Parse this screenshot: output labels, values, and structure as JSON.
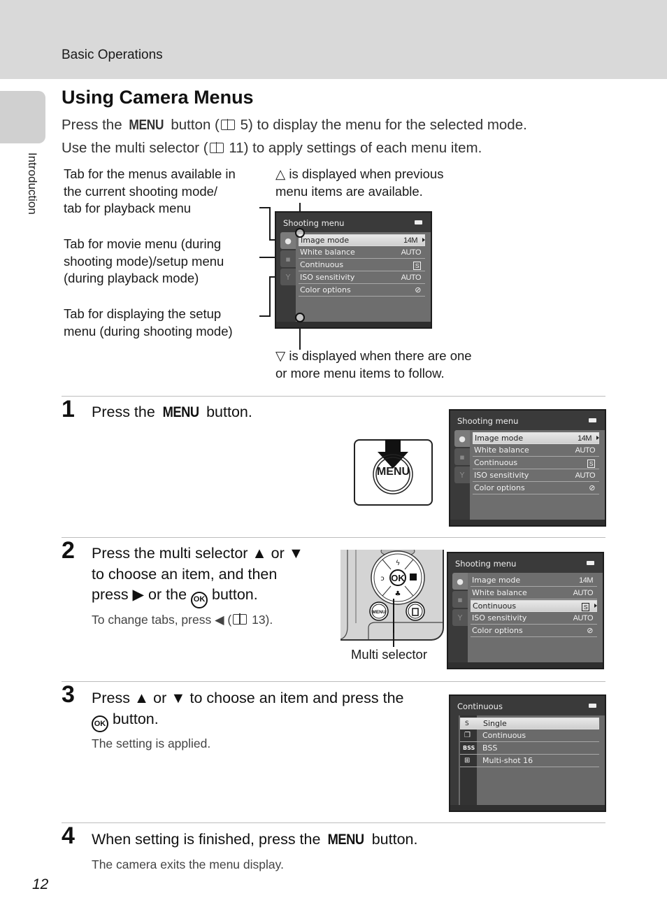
{
  "header": {
    "section": "Basic Operations"
  },
  "side_tab": {
    "label": "Introduction"
  },
  "title": "Using Camera Menus",
  "intro": {
    "line1_a": "Press the ",
    "line1_menu": "MENU",
    "line1_b": " button (",
    "line1_ref": " 5) to display the menu for the selected mode.",
    "line2_a": "Use the multi selector (",
    "line2_ref": " 11) to apply settings of each menu item."
  },
  "diagram": {
    "callout_tab1": "Tab for the menus available in\nthe current shooting mode/\ntab for playback menu",
    "callout_tab2": "Tab for movie menu (during\nshooting mode)/setup menu\n(during playback mode)",
    "callout_tab3": "Tab for displaying the setup\nmenu (during shooting mode)",
    "callout_up_glyph": "△",
    "callout_up": " is displayed when previous\nmenu items are available.",
    "callout_down_glyph": "▽",
    "callout_down": " is displayed when there are one\nor more menu items to follow."
  },
  "shooting_menu": {
    "title": "Shooting menu",
    "tabs": [
      "camera-icon",
      "movie-icon",
      "wrench-icon"
    ],
    "items": [
      {
        "label": "Image mode",
        "value": "14M"
      },
      {
        "label": "White balance",
        "value": "AUTO"
      },
      {
        "label": "Continuous",
        "value": "S"
      },
      {
        "label": "ISO sensitivity",
        "value": "AUTO"
      },
      {
        "label": "Color options",
        "value": "⊘"
      }
    ]
  },
  "continuous_menu": {
    "title": "Continuous",
    "items": [
      {
        "icon": "S",
        "label": "Single"
      },
      {
        "icon": "❐",
        "label": "Continuous"
      },
      {
        "icon": "BSS",
        "label": "BSS"
      },
      {
        "icon": "⊞",
        "label": "Multi-shot 16"
      }
    ]
  },
  "steps": [
    {
      "num": "1",
      "text_a": "Press the ",
      "menu": "MENU",
      "text_b": " button."
    },
    {
      "num": "2",
      "line1": "Press the multi selector ▲ or ▼",
      "line2": "to choose an item, and then",
      "line3_a": "press ▶ or the ",
      "ok": "OK",
      "line3_b": " button.",
      "sub_a": "To change tabs, press ◀ (",
      "sub_b": " 13)."
    },
    {
      "num": "3",
      "line1": "Press ▲ or ▼ to choose an item and press the",
      "ok": "OK",
      "line2_b": " button.",
      "sub": "The setting is applied."
    },
    {
      "num": "4",
      "text_a": "When setting is finished, press the ",
      "menu": "MENU",
      "text_b": " button.",
      "sub": "The camera exits the menu display."
    }
  ],
  "illustrations": {
    "menu_button_label": "MENU",
    "multi_selector_label": "Multi selector",
    "ok_label": "OK",
    "small_menu_label": "MENU"
  },
  "page_number": "12"
}
